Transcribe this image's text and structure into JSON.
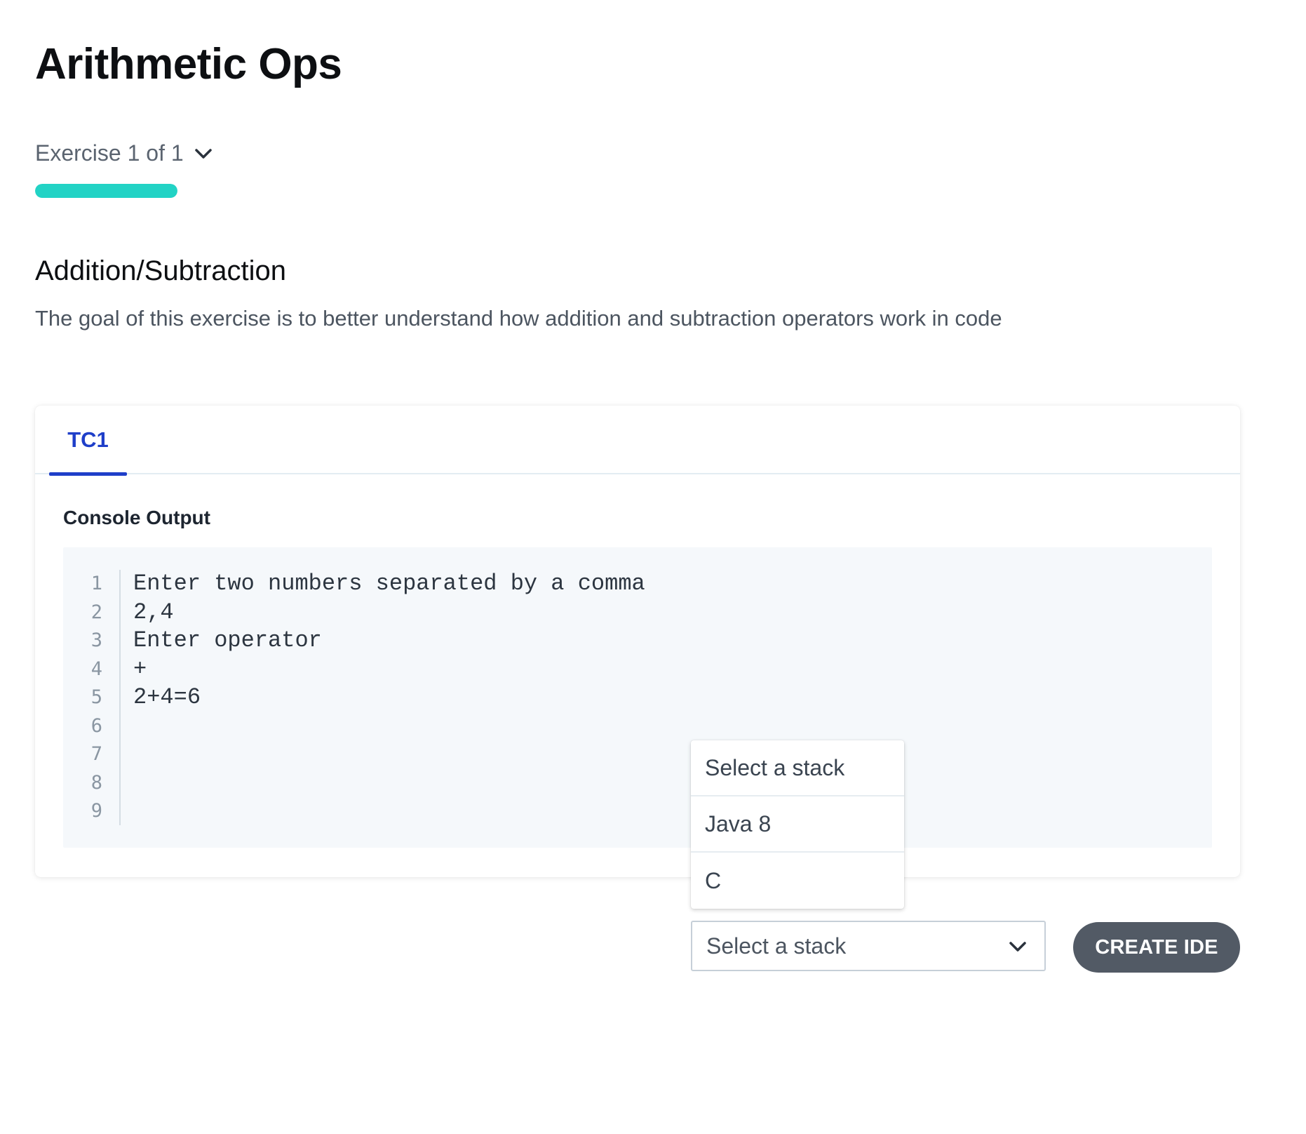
{
  "page": {
    "title": "Arithmetic Ops"
  },
  "exercise_selector": {
    "label": "Exercise 1 of 1",
    "icon": "chevron-down-icon",
    "progress": 1.0,
    "progress_color": "#22d3c5"
  },
  "exercise": {
    "title": "Addition/Subtraction",
    "description": "The goal of this exercise is to better understand how addition and subtraction operators work in code"
  },
  "test_cases": {
    "tabs": [
      {
        "label": "TC1",
        "active": true
      }
    ],
    "accent_color": "#1f3fc9",
    "console": {
      "heading": "Console Output",
      "line_numbers": [
        "1",
        "2",
        "3",
        "4",
        "5",
        "6",
        "7",
        "8",
        "9"
      ],
      "lines": [
        "Enter two numbers separated by a comma",
        "2,4",
        "Enter operator",
        "+",
        "2+4=6",
        "",
        "",
        "",
        ""
      ]
    }
  },
  "stack_dropdown": {
    "open": true,
    "options": [
      "Select a stack",
      "Java 8",
      "C"
    ],
    "selected": "Select a stack",
    "icon": "chevron-down-icon"
  },
  "create_button": {
    "label": "CREATE IDE",
    "color": "#525a65"
  }
}
